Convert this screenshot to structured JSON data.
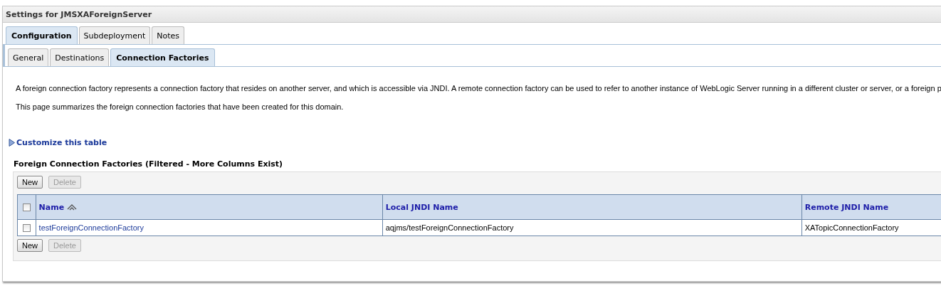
{
  "panel": {
    "title": "Settings for JMSXAForeignServer"
  },
  "tabs": [
    {
      "label": "Configuration",
      "selected": true
    },
    {
      "label": "Subdeployment",
      "selected": false
    },
    {
      "label": "Notes",
      "selected": false
    }
  ],
  "subtabs": [
    {
      "label": "General",
      "selected": false
    },
    {
      "label": "Destinations",
      "selected": false
    },
    {
      "label": "Connection Factories",
      "selected": true
    }
  ],
  "description": [
    "A foreign connection factory represents a connection factory that resides on another server, and which is accessible via JNDI. A remote connection factory can be used to refer to another instance of WebLogic Server running in a different cluster or server, or a foreign p",
    "This page summarizes the foreign connection factories that have been created for this domain."
  ],
  "customize_link": "Customize this table",
  "table": {
    "title": "Foreign Connection Factories (Filtered - More Columns Exist)",
    "buttons_top": [
      {
        "label": "New",
        "disabled": false
      },
      {
        "label": "Delete",
        "disabled": true
      }
    ],
    "select_all": {
      "checked": false
    },
    "columns": [
      {
        "label": "Name",
        "sorted": true
      },
      {
        "label": "Local JNDI Name",
        "sorted": false
      },
      {
        "label": "Remote JNDI Name",
        "sorted": false
      }
    ],
    "rows": [
      {
        "checked": false,
        "cells": [
          "testForeignConnectionFactory",
          "aqjms/testForeignConnectionFactory",
          "XATopicConnectionFactory"
        ]
      }
    ],
    "buttons_bottom": [
      {
        "label": "New",
        "disabled": false
      },
      {
        "label": "Delete",
        "disabled": true
      }
    ]
  }
}
